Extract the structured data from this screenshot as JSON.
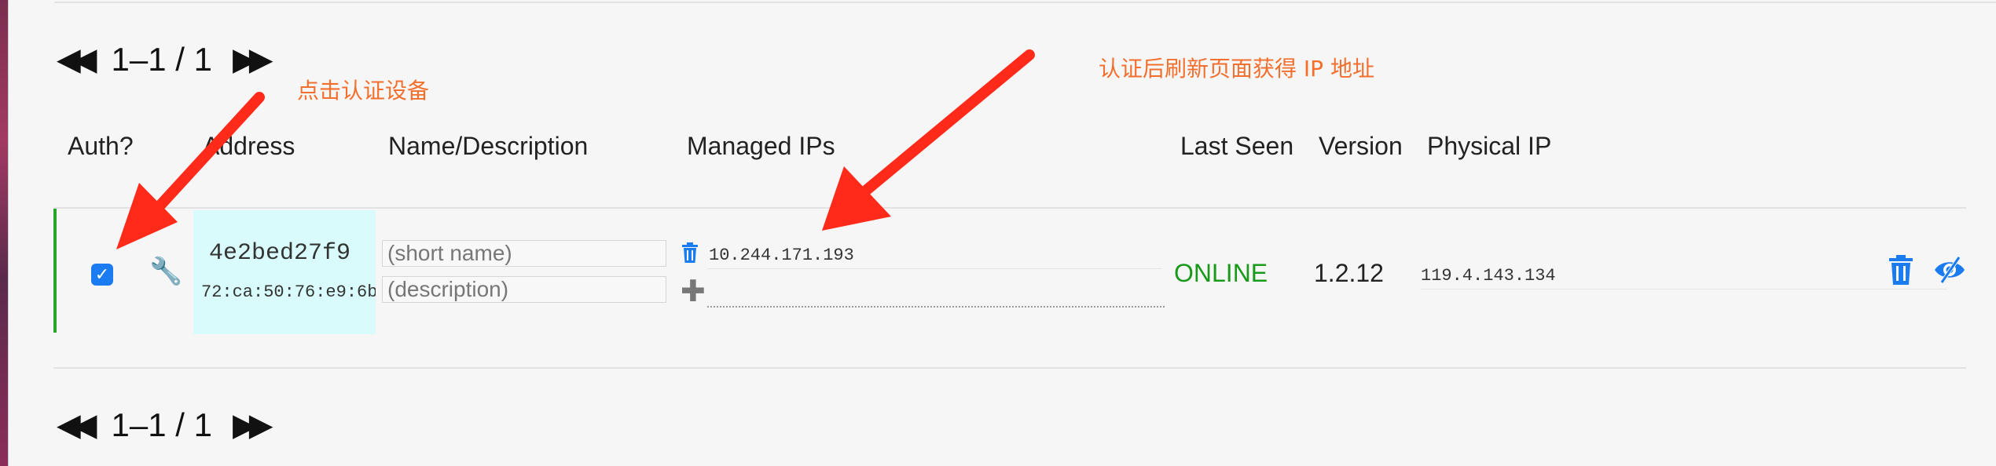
{
  "pagination": {
    "top": {
      "prev_icon": "rewind-icon",
      "label": "1–1 / 1",
      "next_icon": "fast-forward-icon"
    },
    "bottom": {
      "prev_icon": "rewind-icon",
      "label": "1–1 / 1",
      "next_icon": "fast-forward-icon"
    }
  },
  "columns": {
    "auth": "Auth?",
    "address": "Address",
    "name": "Name/Description",
    "managed_ips": "Managed IPs",
    "last_seen": "Last Seen",
    "version": "Version",
    "physical_ip": "Physical IP"
  },
  "member": {
    "authorized": true,
    "address": "4e2bed27f9",
    "mac": "72:ca:50:76:e9:6b",
    "name_placeholder": "(short name)",
    "description_placeholder": "(description)",
    "managed_ip": "10.244.171.193",
    "last_seen": "ONLINE",
    "version": "1.2.12",
    "physical_ip": "119.4.143.134"
  },
  "annotations": {
    "auth_hint": "点击认证设备",
    "ip_hint": "认证后刷新页面获得 IP 地址"
  },
  "colors": {
    "accent": "#1a7cf0",
    "online": "#1a9a1a",
    "row_border": "#2aa52a",
    "address_bg": "#d9fbfb",
    "annotation": "#f26f2d",
    "arrow": "#ff2a1a"
  },
  "icons": {
    "settings": "wrench-icon",
    "delete_ip": "trash-icon",
    "add_ip": "plus-icon",
    "delete_member": "trash-icon",
    "hide": "eye-slash-icon"
  }
}
